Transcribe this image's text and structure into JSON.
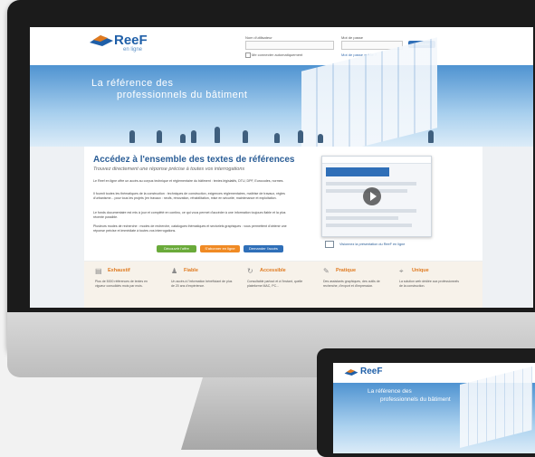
{
  "brand": {
    "name": "ReeF",
    "tagline": "en ligne",
    "colors": {
      "primary": "#2f6fb8",
      "accent": "#e07a1f",
      "green": "#6aaa3a",
      "orange": "#f08a24"
    }
  },
  "login": {
    "username_label": "Nom d'utilisateur",
    "password_label": "Mot de passe",
    "remember_label": "Me connecter automatiquement",
    "forgot_link": "Mot de passe oublié ?",
    "connect_button": "Connexion"
  },
  "hero": {
    "line1": "La référence des",
    "line2": "professionnels du bâtiment"
  },
  "main": {
    "title": "Accédez à l'ensemble des textes de références",
    "subtitle": "Trouvez directement une réponse précise à toutes vos interrogations",
    "paragraphs": [
      "Le Reef en ligne offre un accès au corpus technique et réglementaire du bâtiment : textes législatifs, DTU, DPF, Eurocodes, normes.",
      "Il fournit toutes les thématiques de la construction : techniques de construction, exigences réglementaires, maîtrise de travaux, règles d'urbanisme... pour tous les projets (en travaux : neufs, rénovation, réhabilitation, mise en sécurité, maintenance et exploitation.",
      "Le fonds documentaire est mis à jour et complété en continu, ce qui vous permet d'accéder à une information toujours fiable et la plus récente possible.",
      "Plusieurs modes de recherche : modes de recherche, catalogues thématiques et sectoriels graphiques : vous permettent d'obtenir une réponse précise et immédiate à toutes vos interrogations."
    ],
    "buttons": [
      {
        "label": "Découvrir l'offre",
        "color": "#6aaa3a"
      },
      {
        "label": "S'abonner en ligne",
        "color": "#f08a24"
      },
      {
        "label": "Demander l'accès",
        "color": "#2f6fb8"
      }
    ],
    "video_caption": "Visionnez la présentation du ReeF en ligne"
  },
  "features": [
    {
      "icon": "book-icon",
      "title": "Exhaustif",
      "text": "Plus de 5000 références de textes en vigueur consolidés mois par mois."
    },
    {
      "icon": "people-icon",
      "title": "Fiable",
      "text": "Un accès à l'information bénéficiant de plus de 20 ans d'expérience."
    },
    {
      "icon": "refresh-icon",
      "title": "Accessible",
      "text": "Consultable partout et à l'instant, quelle plateforme MAC, PC..."
    },
    {
      "icon": "tools-icon",
      "title": "Pratique",
      "text": "Des assistants graphiques, des outils de recherche, d'export et d'impression."
    },
    {
      "icon": "pin-icon",
      "title": "Unique",
      "text": "La solution web dédiée aux professionnels de la construction."
    }
  ],
  "tablet": {
    "logo": "ReeF",
    "hero_line1": "La référence des",
    "hero_line2": "professionnels du bâtiment"
  }
}
